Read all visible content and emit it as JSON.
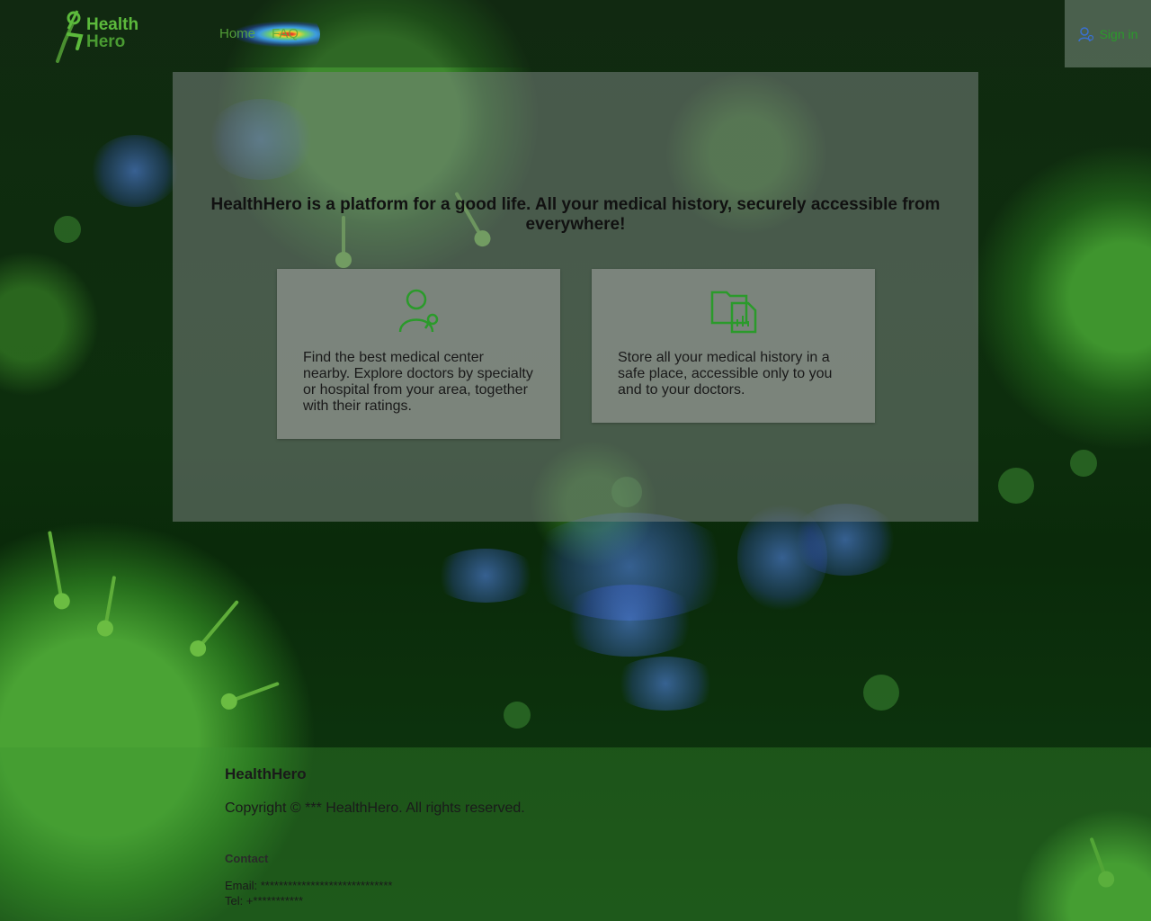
{
  "header": {
    "brand_line1": "Health",
    "brand_line2": "Hero",
    "nav_items": [
      "Home",
      "FAQ"
    ],
    "signin_label": "Sign in"
  },
  "main": {
    "headline": "HealthHero is a platform for a good life. All your medical history, securely accessible from everywhere!",
    "cards": [
      {
        "icon": "doctor-search-icon",
        "text": "Find the best medical center nearby. Explore doctors by specialty or hospital from your area, together with their ratings."
      },
      {
        "icon": "folder-chart-icon",
        "text": "Store all your medical history in a safe place, accessible only to you and to your doctors."
      }
    ]
  },
  "footer": {
    "brand": "HealthHero",
    "copyright": "Copyright © *** HealthHero. All rights reserved.",
    "contact_title": "Contact",
    "email": "Email: *****************************",
    "tel": "Tel: +***********"
  },
  "colors": {
    "accent": "#2b9a2b",
    "brand_green": "#5cba3c"
  }
}
